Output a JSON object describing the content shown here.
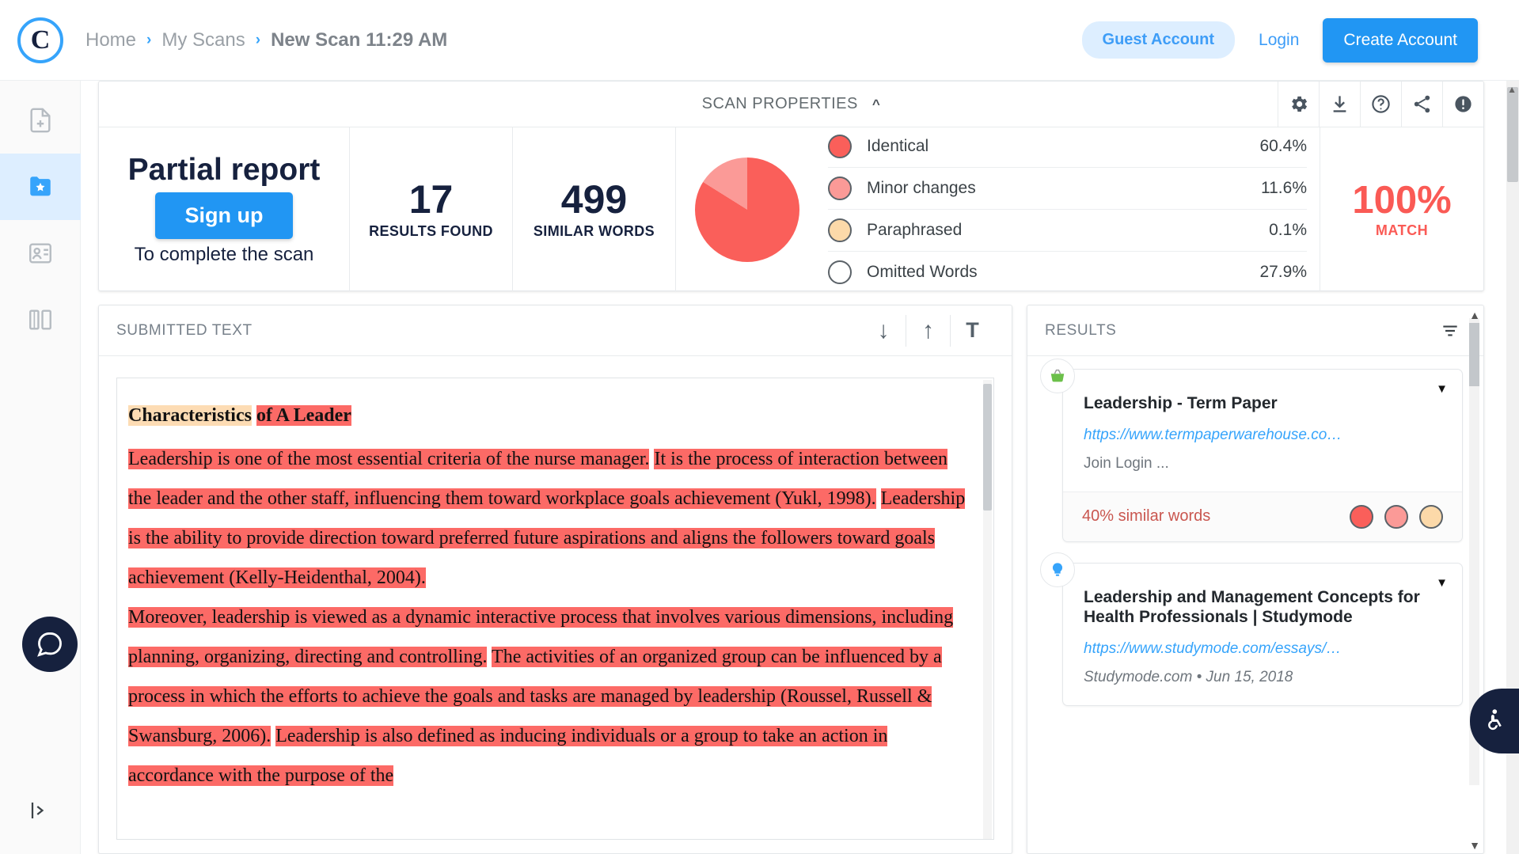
{
  "header": {
    "logo_letter": "C",
    "breadcrumb": [
      {
        "label": "Home"
      },
      {
        "label": "My Scans"
      },
      {
        "label": "New Scan 11:29 AM"
      }
    ],
    "chevron": "›",
    "guest_label": "Guest Account",
    "login_label": "Login",
    "create_account_label": "Create Account"
  },
  "sidebar": {
    "items": [
      {
        "name": "new-scan",
        "icon": "file-plus-icon"
      },
      {
        "name": "my-scans",
        "icon": "star-folder-icon"
      },
      {
        "name": "contacts",
        "icon": "card-icon"
      },
      {
        "name": "compare",
        "icon": "compare-icon"
      }
    ],
    "toggle_icon": "panel-expand-icon"
  },
  "scan_properties": {
    "title": "SCAN PROPERTIES",
    "collapse_icon": "chevron-up-icon",
    "toolbar": [
      {
        "name": "settings",
        "icon": "gear-icon"
      },
      {
        "name": "download",
        "icon": "download-icon"
      },
      {
        "name": "help",
        "icon": "question-circle-icon"
      },
      {
        "name": "share",
        "icon": "share-icon"
      },
      {
        "name": "alert",
        "icon": "exclamation-circle-icon"
      }
    ],
    "partial_title": "Partial report",
    "signup_label": "Sign up",
    "partial_sub": "To complete the scan",
    "stats": [
      {
        "value": "17",
        "label": "RESULTS FOUND"
      },
      {
        "value": "499",
        "label": "SIMILAR WORDS"
      }
    ],
    "match_value": "100%",
    "match_label": "MATCH"
  },
  "chart_data": {
    "type": "pie",
    "title": "Scan composition",
    "categories": [
      "Identical",
      "Minor changes",
      "Paraphrased",
      "Omitted Words"
    ],
    "values": [
      60.4,
      11.6,
      0.1,
      27.9
    ],
    "display_labels": [
      "60.4%",
      "11.6%",
      "0.1%",
      "27.9%"
    ],
    "colors": [
      "#fa5f5a",
      "#fb9a97",
      "#fcd9a9",
      "#ffffff"
    ],
    "legend_position": "right",
    "note": "Pie renders Identical and Minor changes only; Omitted Words shown as empty outline"
  },
  "submitted_text": {
    "title": "SUBMITTED TEXT",
    "tools": [
      {
        "name": "scroll-down",
        "icon": "arrow-down-icon",
        "glyph": "↓"
      },
      {
        "name": "scroll-up",
        "icon": "arrow-up-icon",
        "glyph": "↑"
      },
      {
        "name": "text-format",
        "icon": "text-icon",
        "glyph": "T"
      }
    ],
    "paragraphs": [
      {
        "heading": true,
        "runs": [
          {
            "text": "Characteristics",
            "hl": "peach"
          },
          {
            "text": " ",
            "hl": "none"
          },
          {
            "text": "of A Leader",
            "hl": "red"
          }
        ]
      },
      {
        "heading": false,
        "runs": [
          {
            "text": "Leadership is one of the most essential criteria of the nurse manager.",
            "hl": "red"
          },
          {
            "text": " ",
            "hl": "none"
          },
          {
            "text": "It is the process of interaction between the leader and the other staff, influencing them toward workplace goals achievement (Yukl, 1998).",
            "hl": "red"
          },
          {
            "text": " ",
            "hl": "none"
          },
          {
            "text": "Leadership is the ability to provide direction toward preferred future aspirations and aligns the followers toward goals achievement (Kelly-Heidenthal, 2004).",
            "hl": "red"
          }
        ]
      },
      {
        "heading": false,
        "runs": [
          {
            "text": "Moreover, leadership is viewed as a dynamic interactive process that involves various dimensions, including planning, organizing, directing and controlling.",
            "hl": "red"
          },
          {
            "text": " ",
            "hl": "none"
          },
          {
            "text": "The activities of an organized group can be influenced by a process in which the efforts to achieve the goals and tasks are managed by leadership (Roussel, Russell & Swansburg, 2006).",
            "hl": "red"
          },
          {
            "text": " ",
            "hl": "none"
          },
          {
            "text": "Leadership is also defined as inducing individuals or a group to take an action in accordance with the purpose of the",
            "hl": "red"
          }
        ]
      }
    ]
  },
  "results": {
    "title": "RESULTS",
    "filter_icon": "filter-icon",
    "cards": [
      {
        "badge_icon": "basket-icon",
        "badge_color": "#6cc04a",
        "title": "Leadership - Term Paper",
        "url": "https://www.termpaperwarehouse.co…",
        "snippet": "Join Login ...",
        "meta": "",
        "similar": "40% similar words",
        "dots": [
          "#fa5f5a",
          "#fb9a97",
          "#fcd9a9"
        ],
        "caret": "▼"
      },
      {
        "badge_icon": "lightbulb-icon",
        "badge_color": "#36a4fb",
        "title": "Leadership and Management Concepts for Health Professionals | Studymode",
        "url": "https://www.studymode.com/essays/…",
        "snippet": "",
        "meta": "Studymode.com  •  Jun 15, 2018",
        "similar": "",
        "dots": [],
        "caret": "▼"
      }
    ]
  },
  "accessibility": {
    "icon": "wheelchair-icon"
  },
  "chat": {
    "icon": "chat-bubble-icon"
  }
}
